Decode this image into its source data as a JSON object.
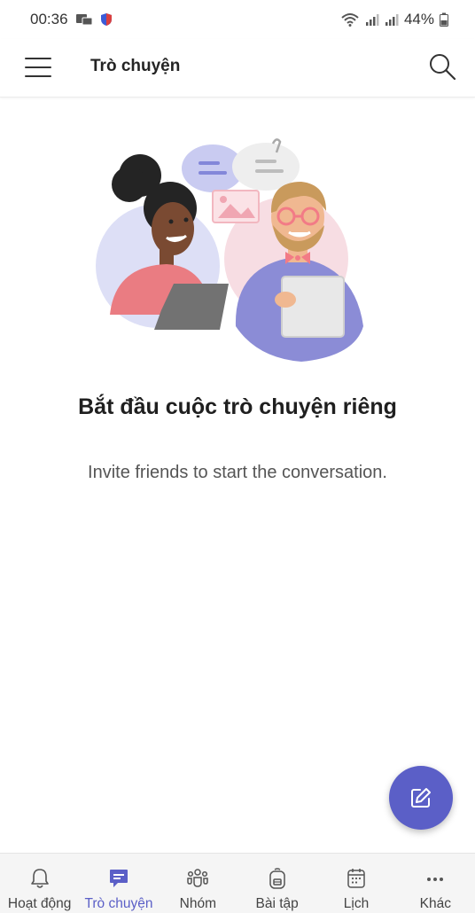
{
  "status_bar": {
    "time": "00:36",
    "battery": "44%"
  },
  "header": {
    "title": "Trò chuyện"
  },
  "empty_state": {
    "title": "Bắt đầu cuộc trò chuyện riêng",
    "subtitle": "Invite friends to start the conversation."
  },
  "fab": {
    "icon": "compose-icon"
  },
  "bottom_nav": {
    "items": [
      {
        "label": "Hoạt động",
        "icon": "bell-icon",
        "active": false
      },
      {
        "label": "Trò chuyện",
        "icon": "chat-icon",
        "active": true
      },
      {
        "label": "Nhóm",
        "icon": "teams-icon",
        "active": false
      },
      {
        "label": "Bài tập",
        "icon": "backpack-icon",
        "active": false
      },
      {
        "label": "Lịch",
        "icon": "calendar-icon",
        "active": false
      },
      {
        "label": "Khác",
        "icon": "more-icon",
        "active": false
      }
    ]
  },
  "colors": {
    "accent": "#5b5fc7",
    "nav_background": "#f5f5f5",
    "text_primary": "#242424",
    "text_secondary": "#555555"
  }
}
